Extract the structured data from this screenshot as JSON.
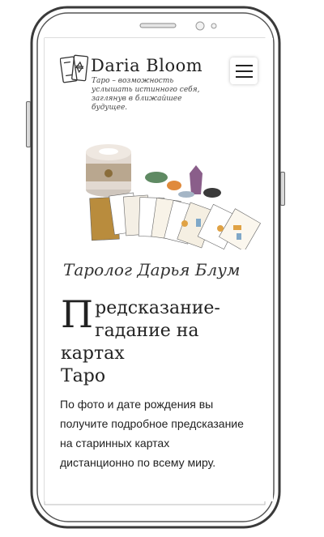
{
  "header": {
    "logo_name": "Daria Bloom",
    "tagline": "Таро – возможность услышать истинного себя, заглянув в ближайшее будущее.",
    "menu_icon": "hamburger-icon"
  },
  "hero": {
    "subtitle": "Таролог Дарья Блум",
    "heading_cap": "П",
    "heading_line1": "редсказание-",
    "heading_line2": "гадание на картах",
    "heading_line3": "Таро",
    "description": "По фото и дате рождения вы получите подробное предсказание на старинных картах дистанционно по всему миру."
  }
}
